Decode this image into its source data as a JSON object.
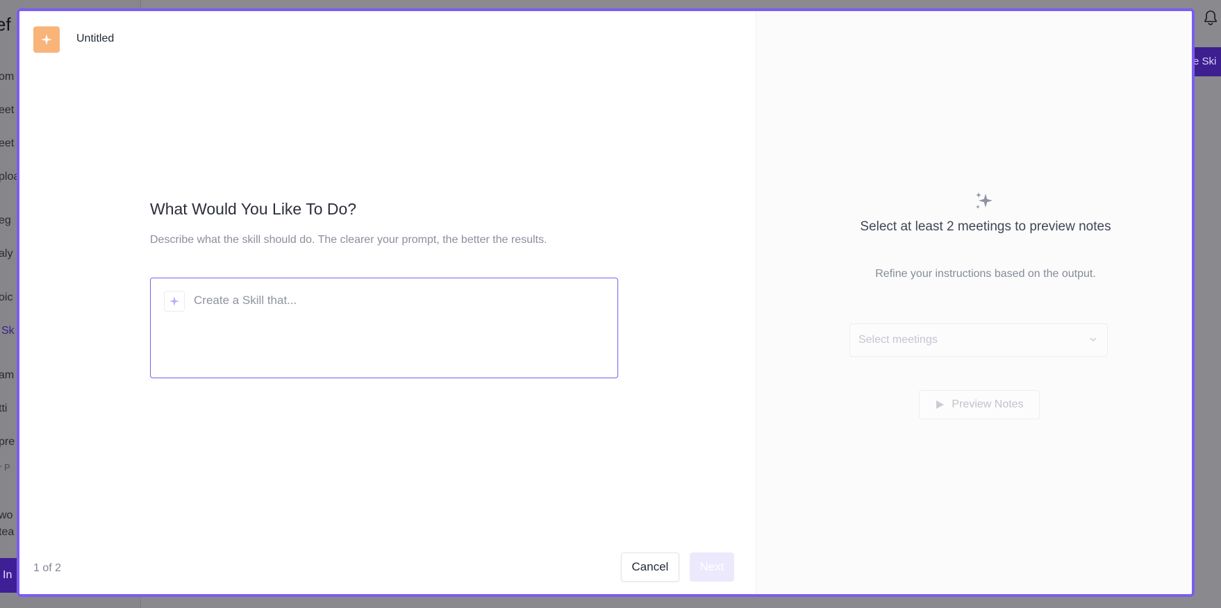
{
  "background": {
    "app_title_fragment": "ef",
    "sidebar_fragments": [
      "om",
      "eet",
      "eet",
      "ploa",
      "eg",
      "aly",
      "oic",
      "Sk",
      "am",
      "tti",
      "pre",
      "r P",
      "wo",
      "tea"
    ],
    "cta_fragment": "In",
    "right_button_fragment": "e Ski",
    "bell": "bell-icon"
  },
  "modal": {
    "header": {
      "logo_icon": "sparkle-icon",
      "title": "Untitled"
    },
    "step": {
      "heading": "What Would You Like To Do?",
      "description": "Describe what the skill should do. The clearer your prompt, the better the results.",
      "prompt": {
        "icon": "sparkle-icon",
        "value": "",
        "placeholder": "Create a Skill that..."
      }
    },
    "footer": {
      "step_count": "1 of 2",
      "cancel_label": "Cancel",
      "next_label": "Next"
    },
    "preview": {
      "icon": "sparkles-icon",
      "title": "Select at least 2 meetings to preview notes",
      "subtitle": "Refine your instructions based on the output.",
      "select_placeholder": "Select meetings",
      "preview_button_label": "Preview Notes"
    }
  },
  "colors": {
    "accent": "#7b5cf0",
    "logo_bg": "#f9b47a",
    "next_disabled_bg": "#ece9fd"
  }
}
